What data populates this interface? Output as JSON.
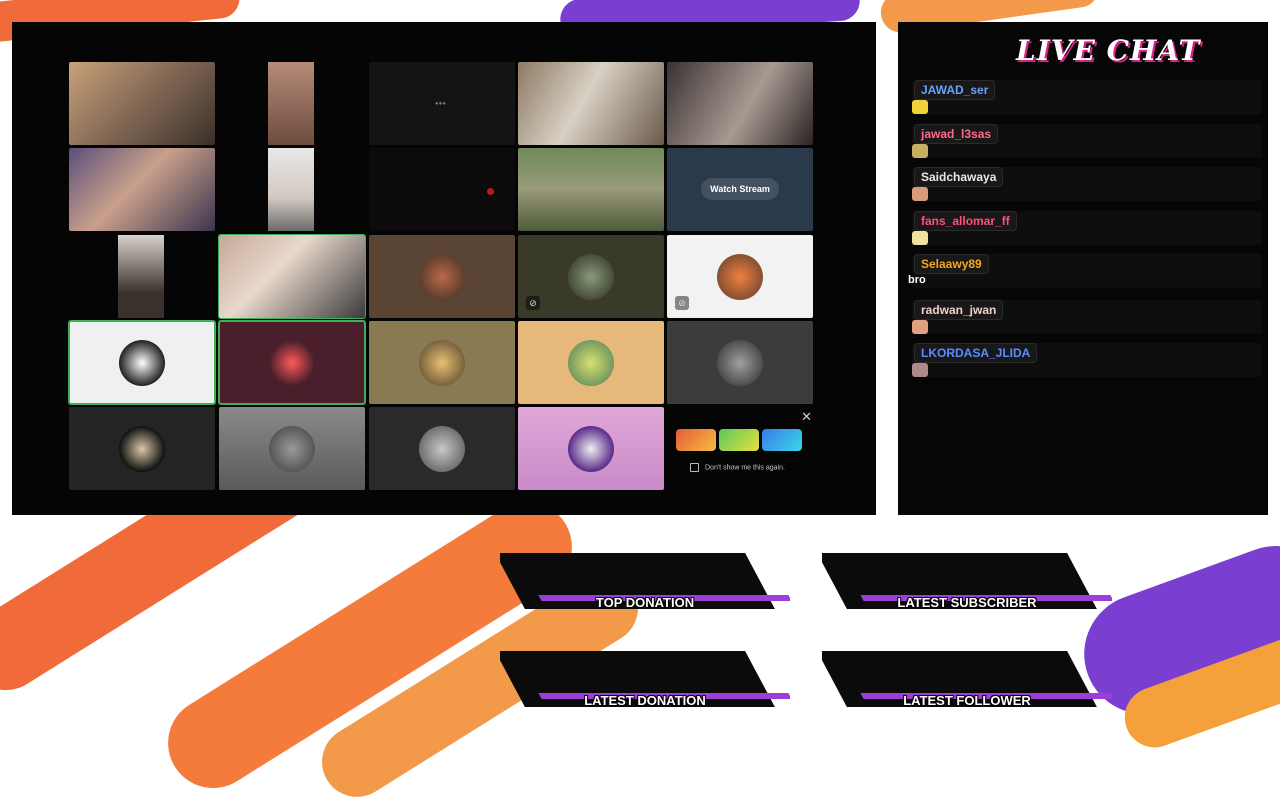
{
  "call": {
    "watch_stream_label": "Watch Stream",
    "promo": {
      "dismiss_label": "Don't show me this again."
    }
  },
  "chat": {
    "title": "LIVE CHAT",
    "messages": [
      {
        "user": "JAWAD_ser",
        "user_color": "#6aa0ff",
        "text": ""
      },
      {
        "user": "jawad_l3sas",
        "user_color": "#ff6a8a",
        "text": ""
      },
      {
        "user": "Saidchawaya",
        "user_color": "#e8e8e8",
        "text": ""
      },
      {
        "user": "fans_allomar_ff",
        "user_color": "#ff4f7a",
        "text": ""
      },
      {
        "user": "Selaawy89",
        "user_color": "#f5a623",
        "text": "bro"
      },
      {
        "user": "radwan_jwan",
        "user_color": "#f0d0c8",
        "text": ""
      },
      {
        "user": "LKORDASA_JLIDA",
        "user_color": "#5a8cff",
        "text": ""
      }
    ]
  },
  "banners": {
    "top_donation": "TOP DONATION",
    "latest_subscriber": "LATEST SUBSCRIBER",
    "latest_donation": "LATEST DONATION",
    "latest_follower": "LATEST FOLLOWER"
  }
}
